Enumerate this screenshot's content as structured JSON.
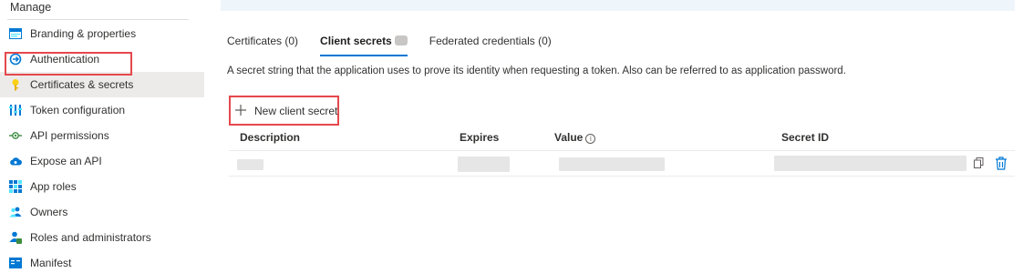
{
  "sidebar": {
    "section_title": "Manage",
    "items": [
      {
        "label": "Branding & properties",
        "icon": "branding-icon"
      },
      {
        "label": "Authentication",
        "icon": "authentication-icon"
      },
      {
        "label": "Certificates & secrets",
        "icon": "key-icon"
      },
      {
        "label": "Token configuration",
        "icon": "token-config-icon"
      },
      {
        "label": "API permissions",
        "icon": "api-permissions-icon"
      },
      {
        "label": "Expose an API",
        "icon": "cloud-icon"
      },
      {
        "label": "App roles",
        "icon": "app-roles-icon"
      },
      {
        "label": "Owners",
        "icon": "owners-icon"
      },
      {
        "label": "Roles and administrators",
        "icon": "roles-admins-icon"
      },
      {
        "label": "Manifest",
        "icon": "manifest-icon"
      }
    ],
    "active_index": 2
  },
  "tabs": [
    {
      "label": "Certificates (0)"
    },
    {
      "label": "Client secrets"
    },
    {
      "label": "Federated credentials (0)"
    }
  ],
  "description": "A secret string that the application uses to prove its identity when requesting a token. Also can be referred to as application password.",
  "new_secret_button": "New client secret",
  "table": {
    "columns": [
      "Description",
      "Expires",
      "Value",
      "Secret ID"
    ]
  },
  "colors": {
    "accent": "#0078d4",
    "highlight": "#e5484d"
  }
}
